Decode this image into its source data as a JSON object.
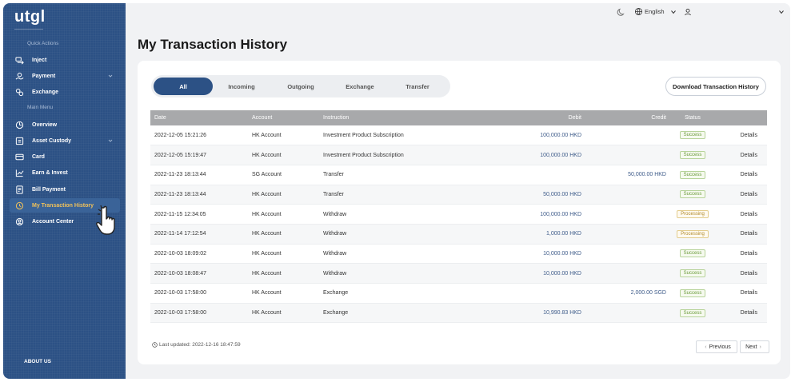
{
  "app": {
    "logo": "utgl"
  },
  "sidebar": {
    "quick_actions_label": "Quick Actions",
    "main_menu_label": "Main Menu",
    "quick_items": [
      {
        "label": "Inject",
        "icon": "inject-icon"
      },
      {
        "label": "Payment",
        "icon": "payment-icon",
        "expandable": true
      },
      {
        "label": "Exchange",
        "icon": "exchange-icon"
      }
    ],
    "menu_items": [
      {
        "label": "Overview",
        "icon": "overview-icon"
      },
      {
        "label": "Asset Custody",
        "icon": "asset-custody-icon",
        "expandable": true
      },
      {
        "label": "Card",
        "icon": "card-icon"
      },
      {
        "label": "Earn & Invest",
        "icon": "chart-icon"
      },
      {
        "label": "Bill Payment",
        "icon": "bill-icon"
      },
      {
        "label": "My Transaction History",
        "icon": "history-icon",
        "active": true
      },
      {
        "label": "Account Center",
        "icon": "user-circle-icon"
      }
    ],
    "about": "ABOUT US"
  },
  "topbar": {
    "language": "English"
  },
  "page": {
    "title": "My Transaction History"
  },
  "tabs": [
    {
      "label": "All",
      "active": true
    },
    {
      "label": "Incoming"
    },
    {
      "label": "Outgoing"
    },
    {
      "label": "Exchange"
    },
    {
      "label": "Transfer"
    }
  ],
  "download_label": "Download Transaction History",
  "table": {
    "headers": {
      "date": "Date",
      "account": "Account",
      "instruction": "Instruction",
      "debit": "Debit",
      "credit": "Credit",
      "status": "Status"
    },
    "details_label": "Details",
    "rows": [
      {
        "date": "2022-12-05 15:21:26",
        "account": "HK Account",
        "instruction": "Investment Product Subscription",
        "debit": "100,000.00 HKD",
        "credit": "",
        "status": "Success"
      },
      {
        "date": "2022-12-05 15:19:47",
        "account": "HK Account",
        "instruction": "Investment Product Subscription",
        "debit": "100,000.00 HKD",
        "credit": "",
        "status": "Success"
      },
      {
        "date": "2022-11-23 18:13:44",
        "account": "SG Account",
        "instruction": "Transfer",
        "debit": "",
        "credit": "50,000.00 HKD",
        "status": "Success"
      },
      {
        "date": "2022-11-23 18:13:44",
        "account": "HK Account",
        "instruction": "Transfer",
        "debit": "50,000.00 HKD",
        "credit": "",
        "status": "Success"
      },
      {
        "date": "2022-11-15 12:34:05",
        "account": "HK Account",
        "instruction": "Withdraw",
        "debit": "100,000.00 HKD",
        "credit": "",
        "status": "Processing"
      },
      {
        "date": "2022-11-14 17:12:54",
        "account": "HK Account",
        "instruction": "Withdraw",
        "debit": "1,000.00 HKD",
        "credit": "",
        "status": "Processing"
      },
      {
        "date": "2022-10-03 18:09:02",
        "account": "HK Account",
        "instruction": "Withdraw",
        "debit": "10,000.00 HKD",
        "credit": "",
        "status": "Success"
      },
      {
        "date": "2022-10-03 18:08:47",
        "account": "HK Account",
        "instruction": "Withdraw",
        "debit": "10,000.00 HKD",
        "credit": "",
        "status": "Success"
      },
      {
        "date": "2022-10-03 17:58:00",
        "account": "HK Account",
        "instruction": "Exchange",
        "debit": "",
        "credit": "2,000.00 SGD",
        "status": "Success"
      },
      {
        "date": "2022-10-03 17:58:00",
        "account": "HK Account",
        "instruction": "Exchange",
        "debit": "10,990.83 HKD",
        "credit": "",
        "status": "Success"
      }
    ]
  },
  "footer": {
    "last_updated": "Last updated: 2022-12-16 18:47:59",
    "previous": "Previous",
    "next": "Next"
  }
}
